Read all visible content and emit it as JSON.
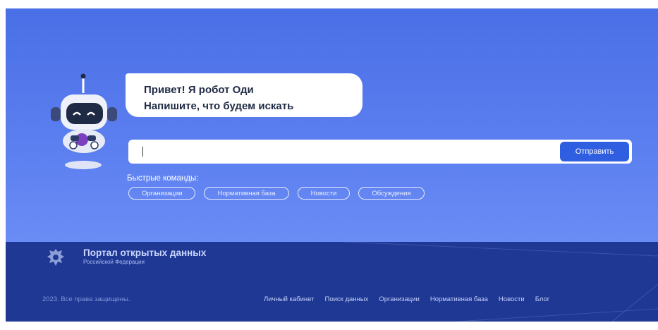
{
  "bubble": {
    "line1": "Привет! Я робот Оди",
    "line2": "Напишите, что будем искать"
  },
  "search": {
    "value": "",
    "send_label": "Отправить",
    "mic_icon": "microphone-icon"
  },
  "quick": {
    "title": "Быстрые команды:",
    "chips": [
      "Организации",
      "Нормативная база",
      "Новости",
      "Обсуждения"
    ]
  },
  "footer": {
    "brand_title": "Портал открытых данных",
    "brand_sub": "Российской Федерации",
    "copyright": "2023. Все права защищены.",
    "nav": [
      "Личный кабинет",
      "Поиск данных",
      "Организации",
      "Нормативная база",
      "Новости",
      "Блог"
    ]
  },
  "colors": {
    "hero": "#4a6fe6",
    "footer": "#1f3894",
    "accent": "#2f5fe0"
  }
}
